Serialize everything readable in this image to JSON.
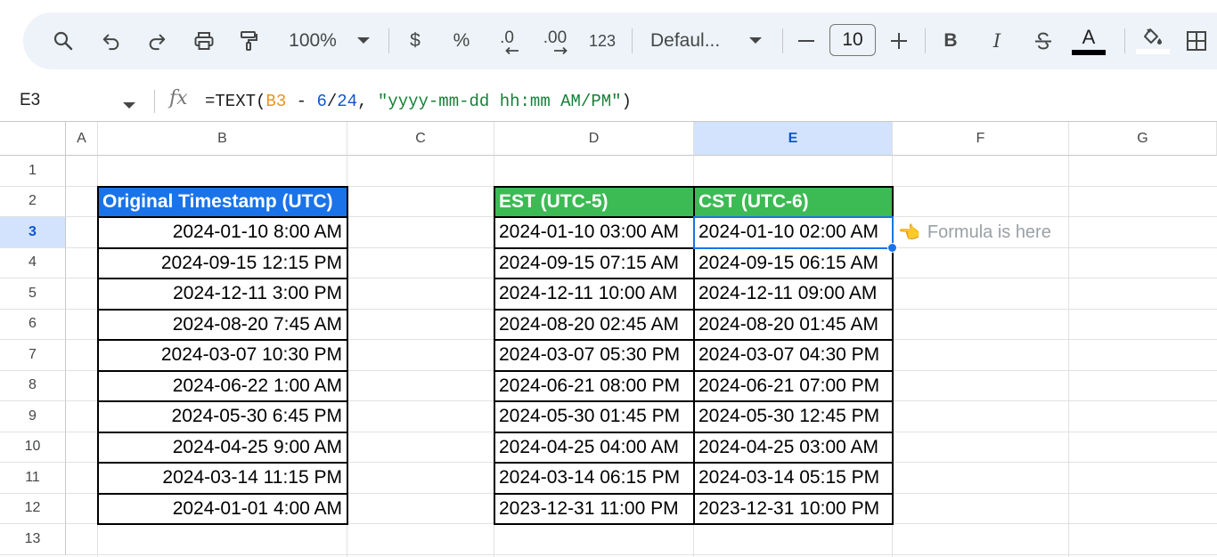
{
  "toolbar": {
    "zoom": "100%",
    "currency": "$",
    "percent": "%",
    "decrease_decimal": ".0",
    "increase_decimal": ".00",
    "number_format": "123",
    "font_name": "Defaul...",
    "font_size": "10",
    "bold": "B",
    "italic": "I",
    "text_color_letter": "A",
    "text_color_hex": "#000000"
  },
  "formula_bar": {
    "cell_ref": "E3",
    "fx": "fx",
    "formula": {
      "prefix": "=TEXT(",
      "ref": "B3",
      "minus": " - ",
      "num1": "6",
      "slash": "/",
      "num2": "24",
      "comma": ", ",
      "str": "\"yyyy-mm-dd hh:mm AM/PM\"",
      "close": ")"
    }
  },
  "sheet": {
    "columns": [
      "A",
      "B",
      "C",
      "D",
      "E",
      "F",
      "G"
    ],
    "selected_column": "E",
    "rows": [
      "1",
      "2",
      "3",
      "4",
      "5",
      "6",
      "7",
      "8",
      "9",
      "10",
      "11",
      "12",
      "13"
    ],
    "selected_row": "3",
    "header_blue": "#1a73e8",
    "header_green": "#3cba54",
    "headers": {
      "original": "Original Timestamp (UTC)",
      "est": "EST (UTC-5)",
      "cst": "CST (UTC-6)"
    },
    "original": [
      "2024-01-10 8:00 AM",
      "2024-09-15 12:15 PM",
      "2024-12-11 3:00 PM",
      "2024-08-20 7:45 AM",
      "2024-03-07 10:30 PM",
      "2024-06-22 1:00 AM",
      "2024-05-30 6:45 PM",
      "2024-04-25 9:00 AM",
      "2024-03-14 11:15 PM",
      "2024-01-01 4:00 AM"
    ],
    "est": [
      "2024-01-10 03:00 AM",
      "2024-09-15 07:15 AM",
      "2024-12-11 10:00 AM",
      "2024-08-20 02:45 AM",
      "2024-03-07 05:30 PM",
      "2024-06-21 08:00 PM",
      "2024-05-30 01:45 PM",
      "2024-04-25 04:00 AM",
      "2024-03-14 06:15 PM",
      "2023-12-31 11:00 PM"
    ],
    "cst": [
      "2024-01-10 02:00 AM",
      "2024-09-15 06:15 AM",
      "2024-12-11 09:00 AM",
      "2024-08-20 01:45 AM",
      "2024-03-07 04:30 PM",
      "2024-06-21 07:00 PM",
      "2024-05-30 12:45 PM",
      "2024-04-25 03:00 AM",
      "2024-03-14 05:15 PM",
      "2023-12-31 10:00 PM"
    ],
    "note": {
      "icon": "pointing-hand-icon",
      "text": "Formula is here"
    }
  }
}
